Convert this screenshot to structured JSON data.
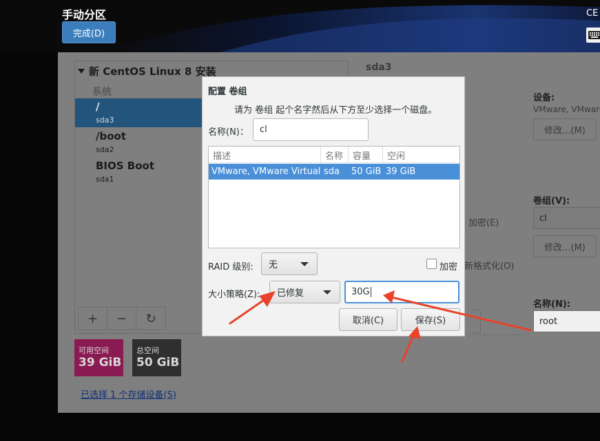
{
  "header": {
    "title": "手动分区",
    "done_button": "完成(D)",
    "os_label": "CE"
  },
  "icons": {
    "keyboard": "keyboard-icon",
    "expand": "triangle-down-icon",
    "add": "plus-icon",
    "remove": "minus-icon",
    "refresh": "refresh-icon",
    "dropdown": "chevron-down-icon"
  },
  "mount_panel": {
    "install_title": "新 CentOS Linux 8 安装",
    "section_label": "系统",
    "items": [
      {
        "name": "/",
        "device": "sda3",
        "selected": true
      },
      {
        "name": "/boot",
        "device": "sda2",
        "selected": false
      },
      {
        "name": "BIOS Boot",
        "device": "sda1",
        "selected": false
      }
    ],
    "tools": [
      "+",
      "−",
      "↻"
    ]
  },
  "space": {
    "available_label": "可用空间",
    "available_value": "39 GiB",
    "total_label": "总空间",
    "total_value": "50 GiB"
  },
  "storage_link": "已选择 1 个存储设备(S)",
  "right_panel": {
    "device_title": "sda3",
    "device_label": "设备:",
    "device_text": "VMware, VMware",
    "modify_label": "修改...(M)",
    "encrypt_label": "加密(E)",
    "volume_group_label": "卷组(V):",
    "volume_group_value": "cl",
    "modify2_label": "修改...(M)",
    "reformat_label": "新格式化(O)",
    "name_label": "名称(N):",
    "name_value": "root"
  },
  "dialog": {
    "title": "配置 卷组",
    "subtitle": "请为 卷组 起个名字然后从下方至少选择一个磁盘。",
    "name_label": "名称(N)：",
    "name_value": "cl",
    "table": {
      "headers": [
        "描述",
        "名称",
        "容量",
        "空闲"
      ],
      "rows": [
        {
          "description": "VMware, VMware Virtual S",
          "name": "sda",
          "capacity": "50 GiB",
          "free": "39 GiB",
          "selected": true
        }
      ]
    },
    "raid_label": "RAID 级别:",
    "raid_value": "无",
    "encrypt_label": "加密",
    "encrypt_checked": false,
    "size_policy_label": "大小策略(Z):",
    "size_policy_value": "已修复",
    "size_value": "30G",
    "cancel_label": "取消(C)",
    "save_label": "保存(S)"
  },
  "colors": {
    "selection": "#23547c",
    "dialog_selection": "#4a90d9",
    "available_space": "#8a1a52",
    "annotation_arrow": "#e8432a"
  }
}
